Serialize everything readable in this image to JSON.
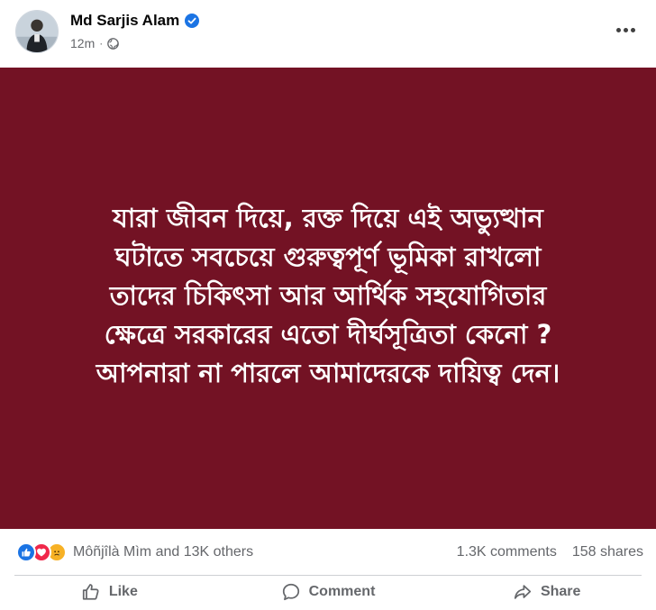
{
  "post": {
    "author": "Md Sarjis Alam",
    "timestamp": "12m",
    "separator": "·",
    "audience_icon": "globe-icon",
    "verified_icon": "verified-badge-icon",
    "more_icon": "more-options-icon",
    "banner": {
      "background": "#731224",
      "text_color": "#ffffff",
      "lines": [
        "যারা জীবন দিয়ে, রক্ত দিয়ে এই অভ্যুত্থান",
        "ঘটাতে সবচেয়ে গুরুত্বপূর্ণ ভূমিকা রাখলো",
        "তাদের চিকিৎসা আর আর্থিক সহযোগিতার",
        "ক্ষেত্রে সরকারের এতো দীর্ঘসূত্রিতা কেনো ?",
        "আপনারা না পারলে আমাদেরকে দায়িত্ব দেন।"
      ]
    }
  },
  "stats": {
    "reaction_icons": [
      "like-reaction-icon",
      "love-reaction-icon",
      "sad-reaction-icon"
    ],
    "reactors": "Môñjîlà Mìm and 13K others",
    "comments": "1.3K comments",
    "shares": "158 shares"
  },
  "actions": {
    "like": "Like",
    "comment": "Comment",
    "share": "Share"
  },
  "colors": {
    "accent": "#1b74e4",
    "muted_text": "#65676b",
    "love": "#f0284a",
    "sad": "#f7b125"
  }
}
